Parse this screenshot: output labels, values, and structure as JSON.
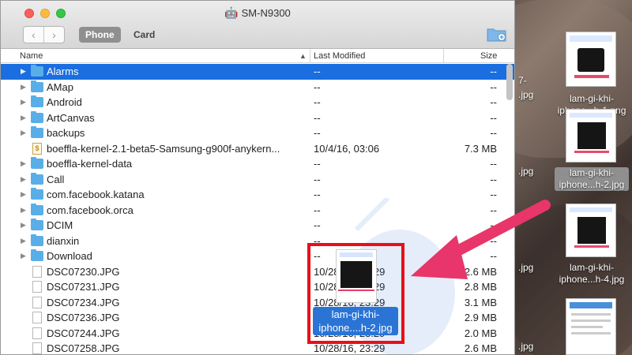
{
  "window": {
    "title": "SM-N9300",
    "tabs": [
      {
        "label": "Phone",
        "selected": true
      },
      {
        "label": "Card",
        "selected": false
      }
    ]
  },
  "columns": {
    "name": "Name",
    "modified": "Last Modified",
    "size": "Size"
  },
  "files": [
    {
      "name": "Alarms",
      "modified": "--",
      "size": "--",
      "type": "folder",
      "selected": true
    },
    {
      "name": "AMap",
      "modified": "--",
      "size": "--",
      "type": "folder"
    },
    {
      "name": "Android",
      "modified": "--",
      "size": "--",
      "type": "folder"
    },
    {
      "name": "ArtCanvas",
      "modified": "--",
      "size": "--",
      "type": "folder"
    },
    {
      "name": "backups",
      "modified": "--",
      "size": "--",
      "type": "folder"
    },
    {
      "name": "boeffla-kernel-2.1-beta5-Samsung-g900f-anykern...",
      "modified": "10/4/16, 03:06",
      "size": "7.3 MB",
      "type": "script"
    },
    {
      "name": "boeffla-kernel-data",
      "modified": "--",
      "size": "--",
      "type": "folder"
    },
    {
      "name": "Call",
      "modified": "--",
      "size": "--",
      "type": "folder"
    },
    {
      "name": "com.facebook.katana",
      "modified": "--",
      "size": "--",
      "type": "folder"
    },
    {
      "name": "com.facebook.orca",
      "modified": "--",
      "size": "--",
      "type": "folder"
    },
    {
      "name": "DCIM",
      "modified": "--",
      "size": "--",
      "type": "folder"
    },
    {
      "name": "dianxin",
      "modified": "--",
      "size": "--",
      "type": "folder"
    },
    {
      "name": "Download",
      "modified": "--",
      "size": "--",
      "type": "folder"
    },
    {
      "name": "DSC07230.JPG",
      "modified": "10/28/16, 23:29",
      "size": "2.6 MB",
      "type": "file"
    },
    {
      "name": "DSC07231.JPG",
      "modified": "10/28/16, 23:29",
      "size": "2.8 MB",
      "type": "file"
    },
    {
      "name": "DSC07234.JPG",
      "modified": "10/28/16, 23:29",
      "size": "3.1 MB",
      "type": "file"
    },
    {
      "name": "DSC07236.JPG",
      "modified": "10/28/16, 23:29",
      "size": "2.9 MB",
      "type": "file"
    },
    {
      "name": "DSC07244.JPG",
      "modified": "10/28/16, 23:29",
      "size": "2.0 MB",
      "type": "file"
    },
    {
      "name": "DSC07258.JPG",
      "modified": "10/28/16, 23:29",
      "size": "2.6 MB",
      "type": "file"
    }
  ],
  "drag_preview": {
    "label_line1": "lam-gi-khi-",
    "label_line2": "iphone....h-2.jpg"
  },
  "desktop": {
    "icons": [
      {
        "label_line1": "lam-gi-khi-",
        "label_line2": "iphone...h-1.png",
        "selected": false
      },
      {
        "label_line1": "lam-gi-khi-",
        "label_line2": "iphone...h-2.jpg",
        "selected": true
      },
      {
        "label_line1": "lam-gi-khi-",
        "label_line2": "iphone...h-4.jpg",
        "selected": false
      }
    ],
    "partial_labels": [
      "7-",
      ".jpg",
      ".jpg",
      ".jpg",
      ".jpg"
    ]
  },
  "colors": {
    "selection": "#1a6ee0",
    "folder": "#5aaee8",
    "highlight_box": "#e8101a",
    "arrow": "#e8356a"
  },
  "icons": {
    "back": "chevron-left-icon",
    "forward": "chevron-right-icon",
    "new_folder": "new-folder-icon",
    "sort": "sort-ascending-icon",
    "title": "android-icon"
  }
}
